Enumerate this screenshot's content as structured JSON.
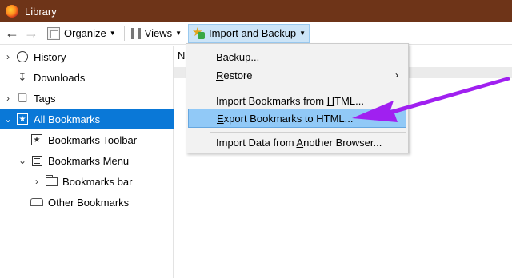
{
  "window": {
    "title": "Library"
  },
  "toolbar": {
    "organize_label": "Organize",
    "views_label": "Views",
    "import_backup_label": "Import and Backup"
  },
  "sidebar": {
    "items": [
      {
        "label": "History",
        "icon": "clock-icon"
      },
      {
        "label": "Downloads",
        "icon": "download-icon"
      },
      {
        "label": "Tags",
        "icon": "tag-icon"
      },
      {
        "label": "All Bookmarks",
        "icon": "star-icon"
      },
      {
        "label": "Bookmarks Toolbar",
        "icon": "star-icon"
      },
      {
        "label": "Bookmarks Menu",
        "icon": "list-icon"
      },
      {
        "label": "Bookmarks bar",
        "icon": "folder-icon"
      },
      {
        "label": "Other Bookmarks",
        "icon": "tray-icon"
      }
    ]
  },
  "main": {
    "column_header": "N"
  },
  "menu": {
    "items": [
      {
        "label_pre": "",
        "label_u": "B",
        "label_post": "ackup..."
      },
      {
        "label_pre": "",
        "label_u": "R",
        "label_post": "estore"
      },
      {
        "label_pre": "Import Bookmarks from ",
        "label_u": "H",
        "label_post": "TML..."
      },
      {
        "label_pre": "",
        "label_u": "E",
        "label_post": "xport Bookmarks to HTML..."
      },
      {
        "label_pre": "Import Data from ",
        "label_u": "A",
        "label_post": "nother Browser..."
      }
    ]
  },
  "colors": {
    "titlebar": "#6e3418",
    "selection": "#0a78d7",
    "menu_highlight": "#91c9f7",
    "annotation_arrow": "#a020f0"
  }
}
